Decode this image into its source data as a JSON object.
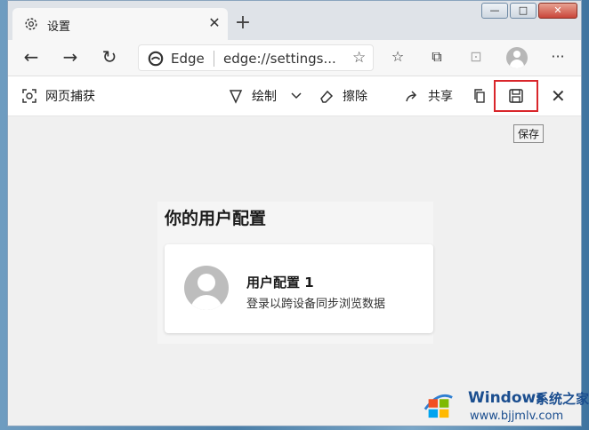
{
  "tab": {
    "title": "设置",
    "new_tab": "+"
  },
  "window_controls": {
    "minimize": "▭",
    "maximize": "□",
    "close": "✕"
  },
  "address": {
    "site": "Edge",
    "url": "edge://settings..."
  },
  "capture_toolbar": {
    "title": "网页捕获",
    "draw": "绘制",
    "erase": "擦除",
    "share": "共享",
    "save_tooltip": "保存"
  },
  "profile_panel": {
    "heading": "你的用户配置",
    "profile_name": "用户配置 1",
    "profile_desc": "登录以跨设备同步浏览数据"
  },
  "watermark": {
    "brand": "Windows",
    "brand_cn": "系统之家",
    "url": "www.bjjmlv.com"
  },
  "colors": {
    "highlight": "#d9262b",
    "accent": "#0078d4"
  }
}
